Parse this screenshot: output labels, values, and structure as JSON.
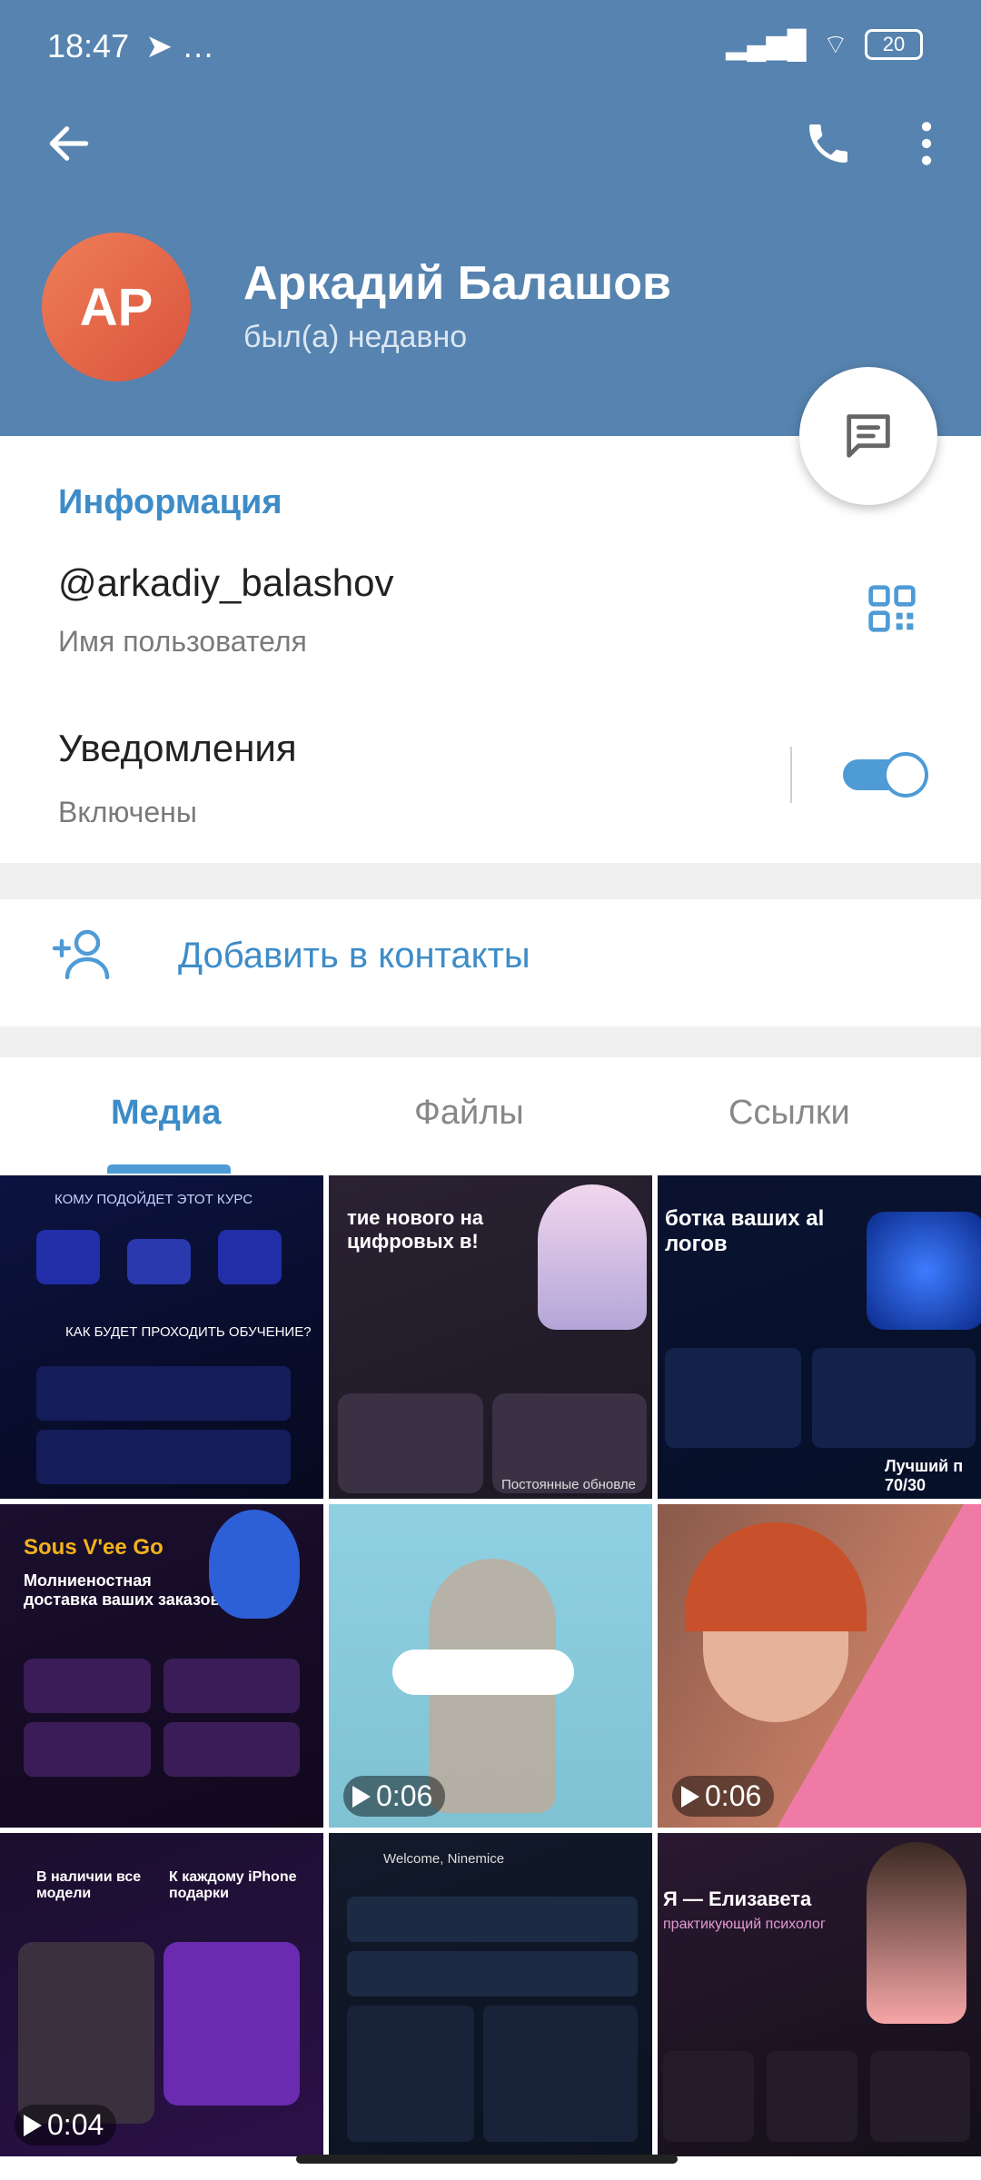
{
  "status_bar": {
    "time": "18:47",
    "left_icons": [
      "telegram-icon",
      "more-dots"
    ],
    "battery": "20"
  },
  "header": {
    "name": "Аркадий Балашов",
    "status": "был(а) недавно",
    "avatar_initials": "AP",
    "color": "#5683af"
  },
  "info": {
    "section_title": "Информация",
    "username": "@arkadiy_balashov",
    "username_label": "Имя пользователя",
    "notifications_title": "Уведомления",
    "notifications_value": "Включены",
    "notifications_on": true
  },
  "add_contact": {
    "label": "Добавить в контакты"
  },
  "tabs": [
    {
      "label": "Медиа",
      "active": true
    },
    {
      "label": "Файлы",
      "active": false
    },
    {
      "label": "Ссылки",
      "active": false
    }
  ],
  "media": [
    {
      "kind": "image",
      "title": "КОМУ ПОДОЙДЕТ ЭТОТ КУРС",
      "sub": "КАК БУДЕТ ПРОХОДИТЬ ОБУЧЕНИЕ?"
    },
    {
      "kind": "image",
      "title": "тие нового на цифровых в!",
      "sub": "Постоянные обновле"
    },
    {
      "kind": "image",
      "title": "ботка ваших al логов",
      "sub": "Лучший п 70/30"
    },
    {
      "kind": "image",
      "title": "Sous V'ee Go",
      "sub": "Молниеностная доставка ваших заказов"
    },
    {
      "kind": "video",
      "duration": "0:06"
    },
    {
      "kind": "video",
      "duration": "0:06"
    },
    {
      "kind": "video",
      "duration": "0:04",
      "title": "В наличии все модели",
      "sub": "К каждому iPhone подарки"
    },
    {
      "kind": "image",
      "title": "Welcome, Ninemice",
      "sub": ""
    },
    {
      "kind": "image",
      "title": "Я — Елизавета",
      "sub": "практикующий психолог"
    }
  ]
}
